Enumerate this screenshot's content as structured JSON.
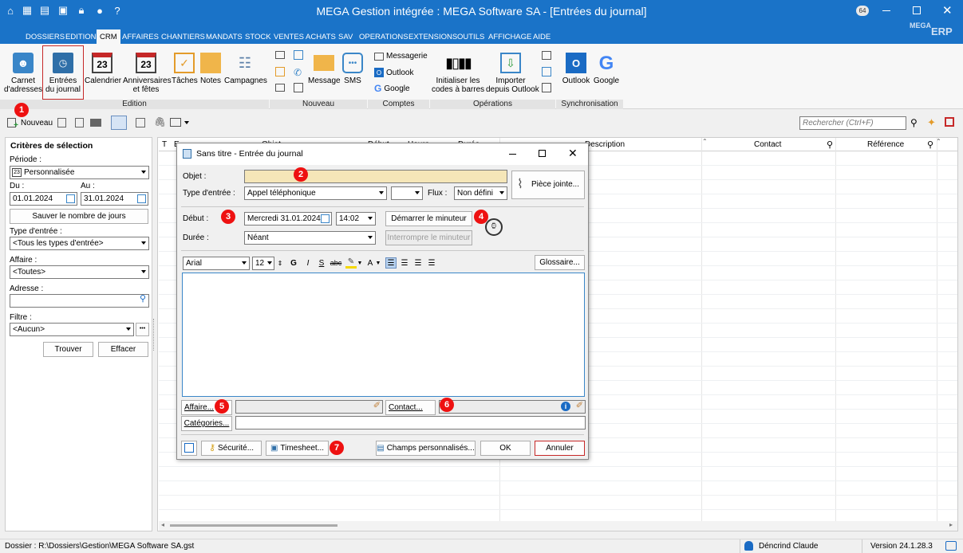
{
  "window": {
    "title": "MEGA Gestion intégrée : MEGA Software SA - [Entrées du journal]",
    "notif_count": "64"
  },
  "menu": [
    "DOSSIERS",
    "EDITION",
    "CRM",
    "AFFAIRES",
    "CHANTIERS",
    "MANDATS",
    "STOCK",
    "VENTES",
    "ACHATS",
    "SAV",
    "OPERATIONS",
    "EXTENSIONS",
    "OUTILS",
    "AFFICHAGE",
    "AIDE"
  ],
  "brand": {
    "name": "MEGA",
    "sub": "ERP"
  },
  "ribbon": {
    "edition": {
      "carnet": "Carnet\nd'adresses",
      "entrees": "Entrées\ndu journal",
      "calendrier": "Calendrier",
      "anniversaires": "Anniversaires\net fêtes",
      "taches": "Tâches",
      "notes": "Notes",
      "campagnes": "Campagnes",
      "label": "Edition",
      "cal_num": "23"
    },
    "nouveau": {
      "message": "Message",
      "sms": "SMS",
      "label": "Nouveau"
    },
    "comptes": {
      "messagerie": "Messagerie",
      "outlook": "Outlook",
      "google": "Google",
      "label": "Comptes"
    },
    "operations": {
      "codes": "Initialiser les\ncodes à barres",
      "importer": "Importer\ndepuis Outlook",
      "label": "Opérations"
    },
    "sync": {
      "outlook": "Outlook",
      "google": "Google",
      "label": "Synchronisation"
    }
  },
  "toolbar": {
    "nouveau": "Nouveau",
    "search_placeholder": "Rechercher (Ctrl+F)"
  },
  "left": {
    "title": "Critères de sélection",
    "periode_label": "Période :",
    "periode": "Personnalisée",
    "periode_icon": "23",
    "du_label": "Du :",
    "du": "01.01.2024",
    "au_label": "Au :",
    "au": "31.01.2024",
    "sauver": "Sauver le nombre de jours",
    "type_label": "Type d'entrée :",
    "type": "<Tous les types d'entrée>",
    "affaire_label": "Affaire :",
    "affaire": "<Toutes>",
    "adresse_label": "Adresse :",
    "filtre_label": "Filtre :",
    "filtre": "<Aucun>",
    "filtre_more": "•••",
    "trouver": "Trouver",
    "effacer": "Effacer"
  },
  "grid": {
    "headers": [
      "T",
      "E",
      "Objet",
      "Début",
      "Heure",
      "Durée",
      "Description",
      "Contact",
      "Référence"
    ]
  },
  "dialog": {
    "title": "Sans titre - Entrée du journal",
    "objet_label": "Objet :",
    "objet": "",
    "type_label": "Type d'entrée :",
    "type": "Appel téléphonique",
    "type2": "",
    "flux_label": "Flux :",
    "flux": "Non défini",
    "piece": "Pièce jointe...",
    "debut_label": "Début :",
    "debut_date": "Mercredi 31.01.2024",
    "debut_time": "14:02",
    "demarrer": "Démarrer le minuteur",
    "duree_label": "Durée :",
    "duree": "Néant",
    "interrompre": "Interrompre le minuteur",
    "font": "Arial",
    "size": "12",
    "bold": "G",
    "italic": "I",
    "underline": "S",
    "strike": "abc",
    "fontcolor": "A",
    "glossaire": "Glossaire...",
    "body": "",
    "affaire": "Affaire...",
    "contact": "Contact...",
    "categories": "Catégories...",
    "securite": "Sécurité...",
    "timesheet": "Timesheet...",
    "champs": "Champs personnalisés...",
    "ok": "OK",
    "annuler": "Annuler"
  },
  "badges": [
    "1",
    "2",
    "3",
    "4",
    "5",
    "6",
    "7"
  ],
  "status": {
    "dossier": "Dossier : R:\\Dossiers\\Gestion\\MEGA Software SA.gst",
    "user": "Déncrind Claude",
    "version": "Version 24.1.28.3"
  },
  "colors": {
    "titlebar": "#1a73c8",
    "badge": "#e11111",
    "highlight": "#c62828",
    "objet_bg": "#f5e6b8"
  }
}
